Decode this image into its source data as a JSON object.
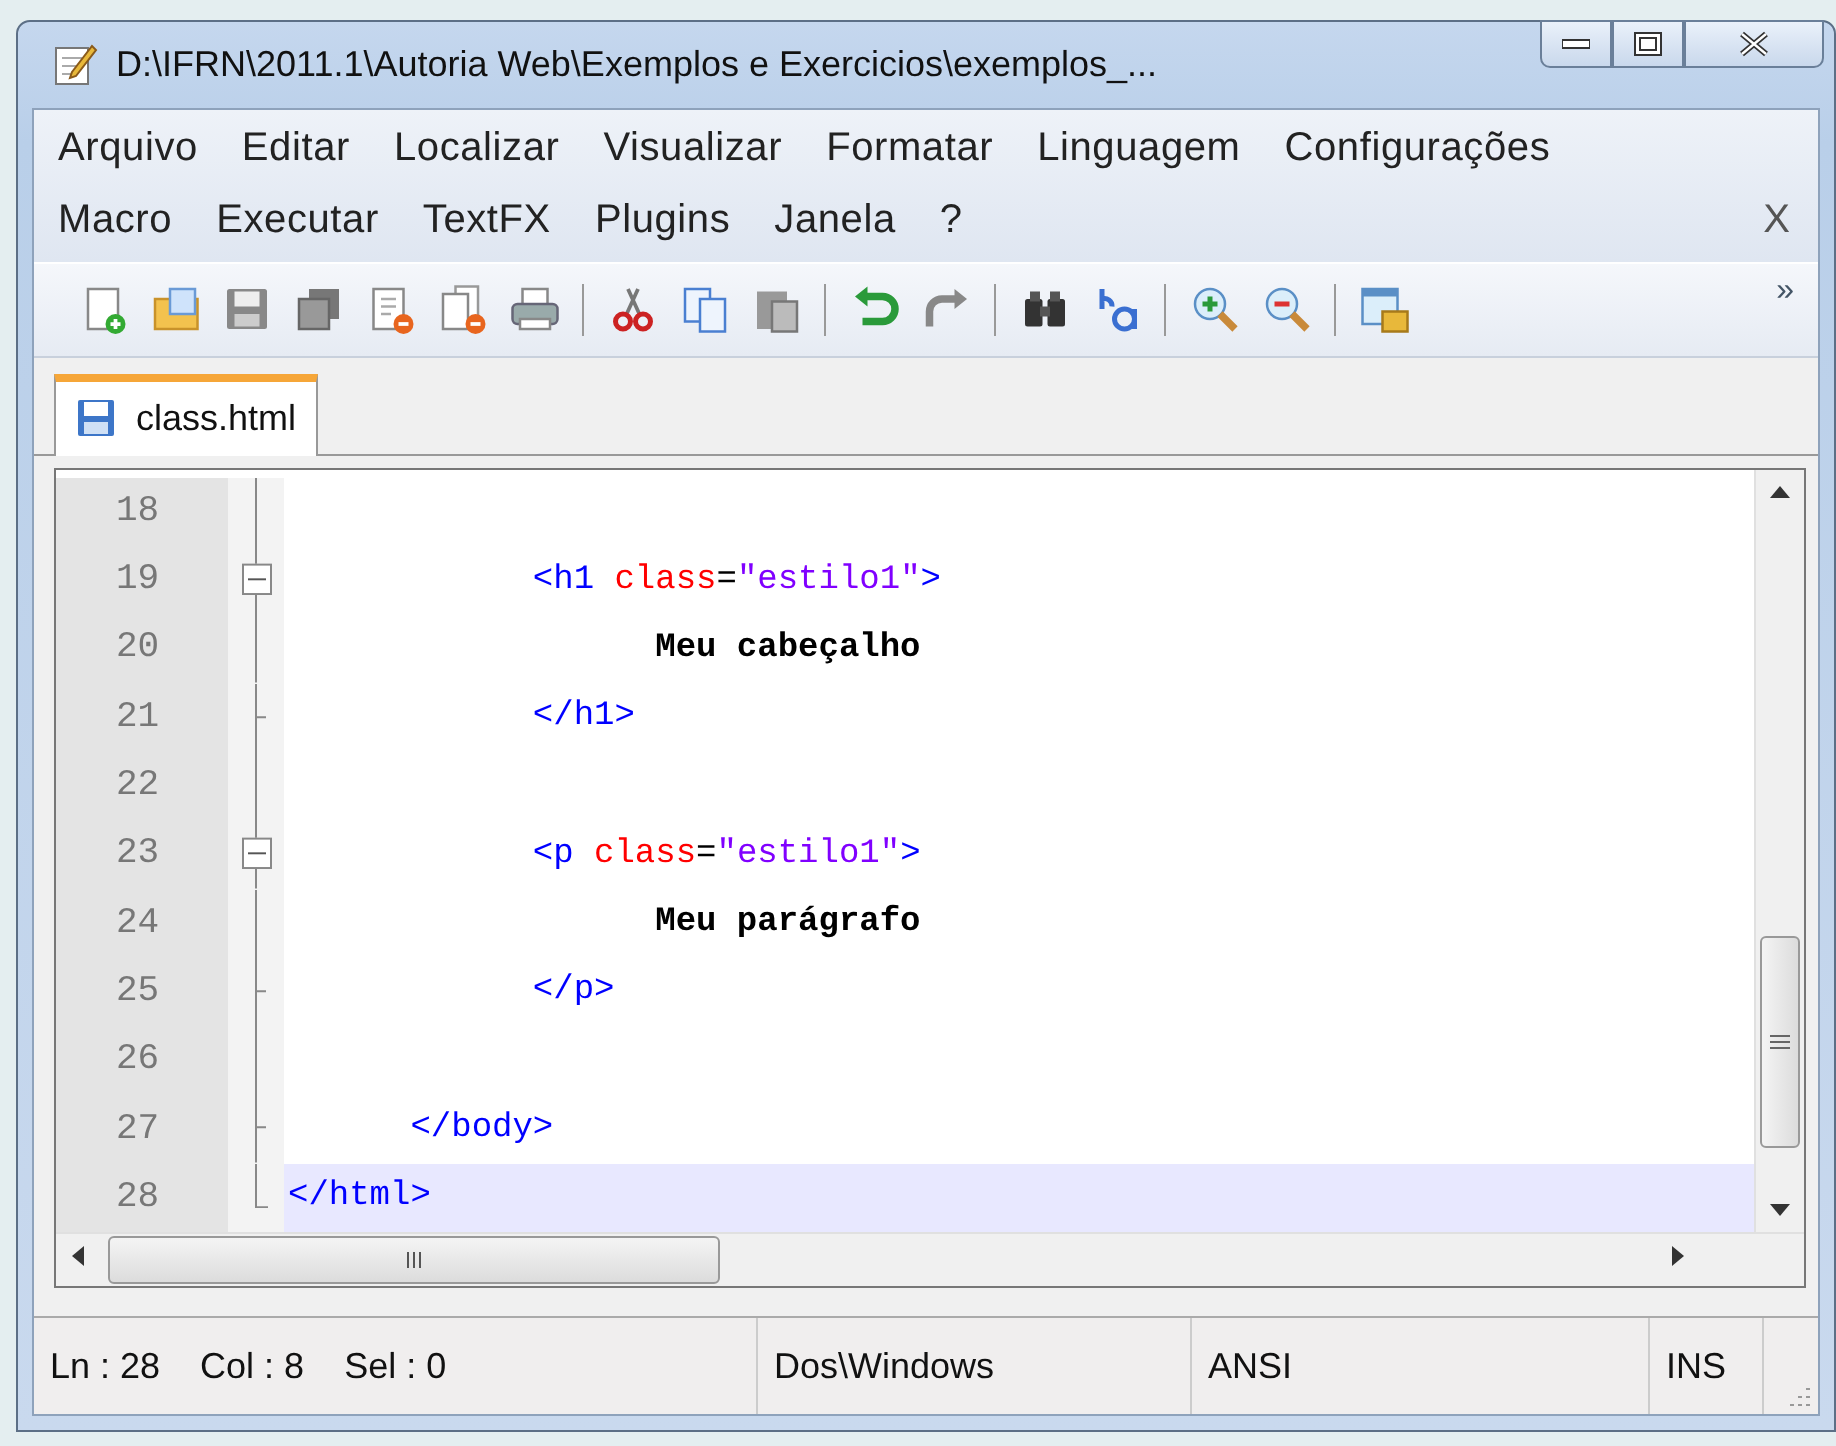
{
  "window": {
    "title": "D:\\IFRN\\2011.1\\Autoria Web\\Exemplos e Exercicios\\exemplos_..."
  },
  "menu_rows": [
    [
      {
        "label": "Arquivo"
      },
      {
        "label": "Editar"
      },
      {
        "label": "Localizar"
      },
      {
        "label": "Visualizar"
      },
      {
        "label": "Formatar"
      },
      {
        "label": "Linguagem"
      },
      {
        "label": "Configurações"
      }
    ],
    [
      {
        "label": "Macro"
      },
      {
        "label": "Executar"
      },
      {
        "label": "TextFX"
      },
      {
        "label": "Plugins"
      },
      {
        "label": "Janela"
      },
      {
        "label": "?"
      }
    ]
  ],
  "menu_close": "X",
  "toolbar": [
    [
      {
        "kind": "new"
      },
      {
        "kind": "open"
      },
      {
        "kind": "save"
      },
      {
        "kind": "saveall"
      },
      {
        "kind": "close"
      },
      {
        "kind": "closeall"
      },
      {
        "kind": "print"
      }
    ],
    [
      {
        "kind": "cut"
      },
      {
        "kind": "copy"
      },
      {
        "kind": "paste"
      }
    ],
    [
      {
        "kind": "undo"
      },
      {
        "kind": "redo"
      }
    ],
    [
      {
        "kind": "find"
      },
      {
        "kind": "replace"
      }
    ],
    [
      {
        "kind": "zoomin"
      },
      {
        "kind": "zoomout"
      }
    ],
    [
      {
        "kind": "sync"
      }
    ]
  ],
  "toolbar_overflow": "»",
  "tabs": [
    {
      "label": "class.html",
      "selected": true
    }
  ],
  "editor": {
    "lines": [
      {
        "number": "18",
        "kind": "guide",
        "current": false
      },
      {
        "number": "19",
        "kind": "open",
        "current": false,
        "tokens": [
          {
            "kind": "tag",
            "text": "            <h1"
          },
          {
            "kind": "attr",
            "text": " class"
          },
          {
            "kind": "op",
            "text": "="
          },
          {
            "kind": "string",
            "text": "\"estilo1\""
          },
          {
            "kind": "tag",
            "text": ">"
          }
        ]
      },
      {
        "number": "20",
        "kind": "guide",
        "current": false,
        "tokens": [
          {
            "kind": "text",
            "text": "                  Meu cabeçalho"
          }
        ]
      },
      {
        "number": "21",
        "kind": "tick",
        "current": false,
        "tokens": [
          {
            "kind": "tag",
            "text": "            </h1>"
          }
        ]
      },
      {
        "number": "22",
        "kind": "guide",
        "current": false
      },
      {
        "number": "23",
        "kind": "open",
        "current": false,
        "tokens": [
          {
            "kind": "tag",
            "text": "            <p"
          },
          {
            "kind": "attr",
            "text": " class"
          },
          {
            "kind": "op",
            "text": "="
          },
          {
            "kind": "string",
            "text": "\"estilo1\""
          },
          {
            "kind": "tag",
            "text": ">"
          }
        ]
      },
      {
        "number": "24",
        "kind": "guide",
        "current": false,
        "tokens": [
          {
            "kind": "text",
            "text": "                  Meu parágrafo"
          }
        ]
      },
      {
        "number": "25",
        "kind": "tick",
        "current": false,
        "tokens": [
          {
            "kind": "tag",
            "text": "            </p>"
          }
        ]
      },
      {
        "number": "26",
        "kind": "guide",
        "current": false
      },
      {
        "number": "27",
        "kind": "tick",
        "current": false,
        "tokens": [
          {
            "kind": "tag",
            "text": "      </body>"
          }
        ]
      },
      {
        "number": "28",
        "kind": "end",
        "current": true,
        "tokens": [
          {
            "kind": "tag",
            "text": "</html>"
          }
        ]
      }
    ]
  },
  "status_bar": {
    "position": [
      {
        "text": "Ln : 28"
      },
      {
        "text": "Col : 8"
      },
      {
        "text": "Sel : 0"
      }
    ],
    "line_ending": "Dos\\Windows",
    "encoding": "ANSI",
    "mode": "INS"
  }
}
